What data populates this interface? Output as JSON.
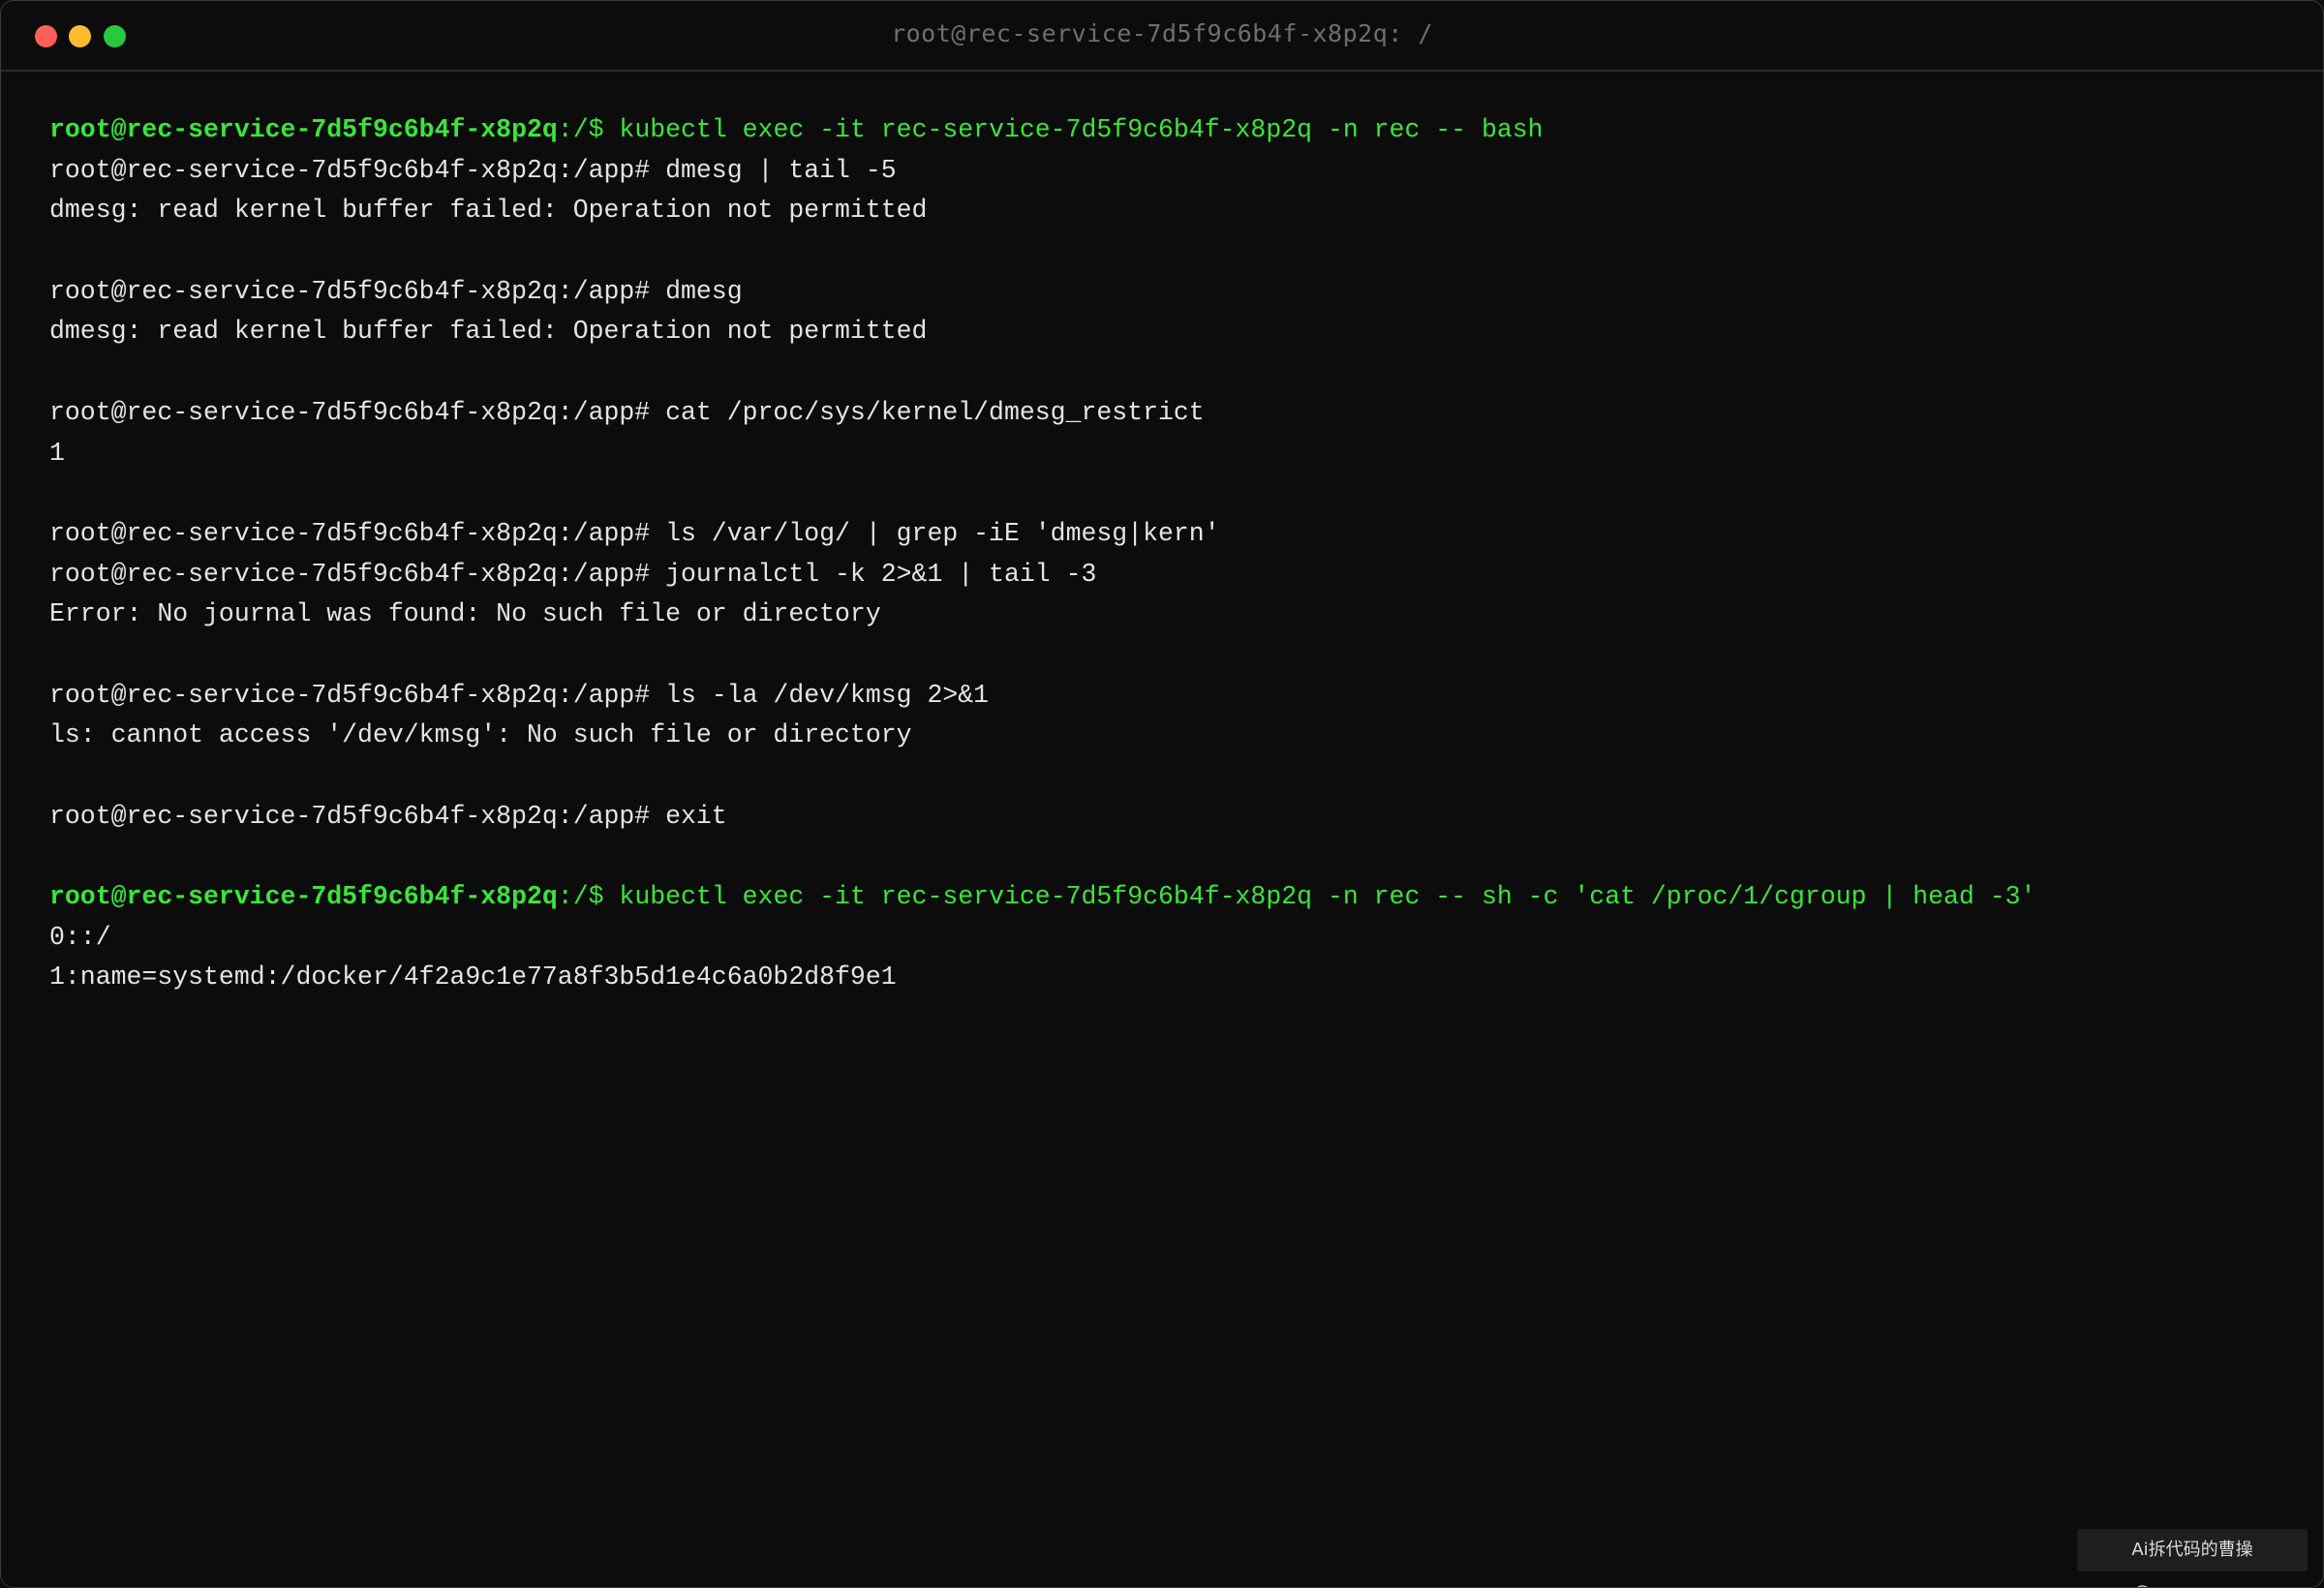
{
  "window": {
    "title": "root@rec-service-7d5f9c6b4f-x8p2q: /",
    "controls": {
      "close": "close-icon",
      "minimize": "minimize-icon",
      "maximize": "maximize-icon"
    }
  },
  "colors": {
    "prompt_green": "#39e639",
    "text": "#e4e4e4",
    "background": "#0c0c0c",
    "title": "#6e6e6e"
  },
  "terminal": {
    "lines": [
      {
        "type": "host-prompt",
        "user": "root@rec-service-7d5f9c6b4f-x8p2q",
        "path": ":/$ ",
        "cmd": "kubectl exec -it rec-service-7d5f9c6b4f-x8p2q -n rec -- bash"
      },
      {
        "type": "plain",
        "text": "root@rec-service-7d5f9c6b4f-x8p2q:/app# dmesg | tail -5"
      },
      {
        "type": "plain",
        "text": "dmesg: read kernel buffer failed: Operation not permitted"
      },
      {
        "type": "blank",
        "text": ""
      },
      {
        "type": "plain",
        "text": "root@rec-service-7d5f9c6b4f-x8p2q:/app# dmesg"
      },
      {
        "type": "plain",
        "text": "dmesg: read kernel buffer failed: Operation not permitted"
      },
      {
        "type": "blank",
        "text": ""
      },
      {
        "type": "plain",
        "text": "root@rec-service-7d5f9c6b4f-x8p2q:/app# cat /proc/sys/kernel/dmesg_restrict"
      },
      {
        "type": "plain",
        "text": "1"
      },
      {
        "type": "blank",
        "text": ""
      },
      {
        "type": "plain",
        "text": "root@rec-service-7d5f9c6b4f-x8p2q:/app# ls /var/log/ | grep -iE 'dmesg|kern'"
      },
      {
        "type": "plain",
        "text": "root@rec-service-7d5f9c6b4f-x8p2q:/app# journalctl -k 2>&1 | tail -3"
      },
      {
        "type": "plain",
        "text": "Error: No journal was found: No such file or directory"
      },
      {
        "type": "blank",
        "text": ""
      },
      {
        "type": "plain",
        "text": "root@rec-service-7d5f9c6b4f-x8p2q:/app# ls -la /dev/kmsg 2>&1"
      },
      {
        "type": "plain",
        "text": "ls: cannot access '/dev/kmsg': No such file or directory"
      },
      {
        "type": "blank",
        "text": ""
      },
      {
        "type": "plain",
        "text": "root@rec-service-7d5f9c6b4f-x8p2q:/app# exit"
      },
      {
        "type": "blank",
        "text": ""
      },
      {
        "type": "host-prompt",
        "user": "root@rec-service-7d5f9c6b4f-x8p2q",
        "path": ":/$ ",
        "cmd": "kubectl exec -it rec-service-7d5f9c6b4f-x8p2q -n rec -- sh -c 'cat /proc/1/cgroup | head -3'"
      },
      {
        "type": "plain",
        "text": "0::/"
      },
      {
        "type": "plain",
        "text": "1:name=systemd:/docker/4f2a9c1e77a8f3b5d1e4c6a0b2d8f9e1"
      }
    ]
  },
  "watermark": {
    "text": "Ai拆代码的曹操@opencao.cn"
  }
}
